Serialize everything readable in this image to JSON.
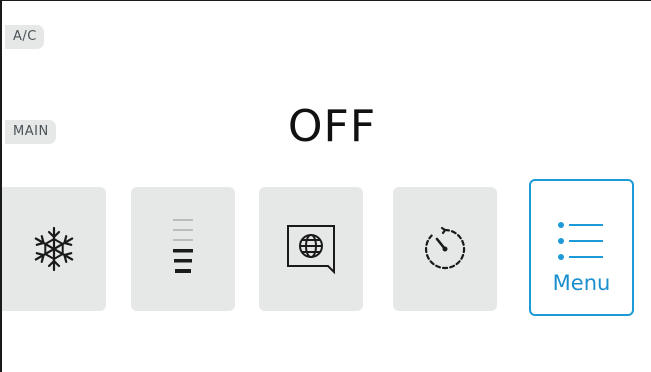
{
  "tags": {
    "ac": "A/C",
    "main": "MAIN"
  },
  "status": {
    "power": "OFF"
  },
  "tiles": [
    {
      "id": "cool",
      "icon": "snowflake-icon"
    },
    {
      "id": "fan",
      "icon": "fan-speed-icon"
    },
    {
      "id": "language",
      "icon": "globe-chat-icon"
    },
    {
      "id": "timer",
      "icon": "timer-icon"
    },
    {
      "id": "menu",
      "icon": "menu-list-icon",
      "label": "Menu"
    }
  ],
  "colors": {
    "tile_bg": "#e6e8e8",
    "accent": "#1e9ad6",
    "icon": "#1a1a1a",
    "text": "#111111"
  }
}
